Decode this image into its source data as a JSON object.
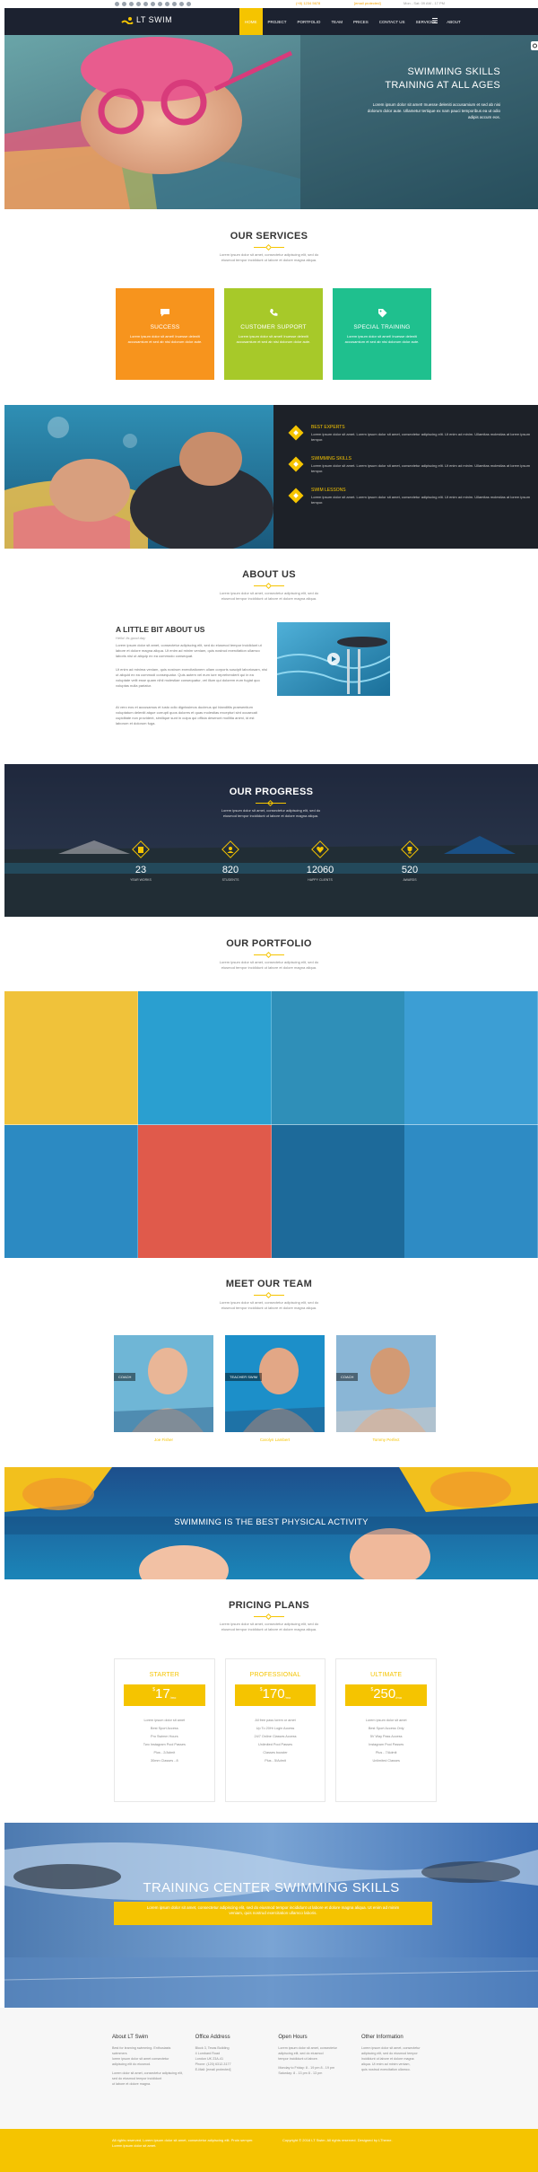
{
  "topbar": {
    "social_icons": [
      "facebook-icon",
      "twitter-icon",
      "google-plus-icon",
      "pinterest-icon",
      "linkedin-icon",
      "youtube-icon",
      "dribbble-icon",
      "instagram-icon",
      "rss-icon",
      "flickr-icon",
      "vimeo-icon"
    ],
    "phone": "(+8) 1234 5678",
    "email": "[email protected]",
    "hours": "Mon - Sat: 09 AM - 17 PM"
  },
  "nav": {
    "logo": "LT SWIM",
    "items": [
      "HOME",
      "PROJECT",
      "PORTFOLIO",
      "TEAM",
      "PRICES",
      "CONTACT US",
      "SERVICES",
      "ABOUT"
    ],
    "active_index": 0,
    "accent": "#f5c400",
    "bg": "#1c2230"
  },
  "hero": {
    "title_line1": "SWIMMING SKILLS",
    "title_line2": "TRAINING AT ALL AGES",
    "text": "Lorem ipsum dolor sit amet! Inuesse deleniti accusamium et sed ab nisi dolorum dolor aute. Ullametur tertique ex nam pauci temporibus ea ut odio adipis accum eos."
  },
  "services": {
    "title": "OUR SERVICES",
    "subtitle": "Lorem ipsum dolor sit amet, consectetur adipiscing elit, sed do eiusmod tempor incididunt ut labore et dolore magna aliqua.",
    "cards": [
      {
        "icon": "chat-icon",
        "title": "SUCCESS",
        "text": "Lorem ipsum dolor sit amet! Inuesse deleniti accusamium et sed ab nisi dolorum dolor aute.",
        "color": "#f7941d"
      },
      {
        "icon": "phone-icon",
        "title": "CUSTOMER SUPPORT",
        "text": "Lorem ipsum dolor sit amet! Inuesse deleniti accusamium et sed ab nisi dolorum dolor aute.",
        "color": "#a7c929"
      },
      {
        "icon": "tag-icon",
        "title": "SPECIAL TRAINING",
        "text": "Lorem ipsum dolor sit amet! Inuesse deleniti accusamium et sed ab nisi dolorum dolor aute.",
        "color": "#1fc08e"
      }
    ]
  },
  "features": {
    "items": [
      {
        "title": "BEST EXPERTS",
        "text": "Lorem ipsum dolor sit amet. Lorem ipsum dolor sit amet, consectetur adipiscing elit. Ut enim ad minim. Ullamitas molestias at lorem ipsum tempor."
      },
      {
        "title": "SWIMMING SKILLS",
        "text": "Lorem ipsum dolor sit amet. Lorem ipsum dolor sit amet, consectetur adipiscing elit. Ut enim ad minim. Ullamitas molestias at lorem ipsum tempor."
      },
      {
        "title": "SWIM LESSONS",
        "text": "Lorem ipsum dolor sit amet. Lorem ipsum dolor sit amet, consectetur adipiscing elit. Ut enim ad minim. Ullamitas molestias at lorem ipsum tempor."
      }
    ]
  },
  "about": {
    "title": "ABOUT US",
    "subtitle": "Lorem ipsum dolor sit amet, consectetur adipiscing elit, sed do eiusmod tempor incididunt ut labore et dolore magna aliqua.",
    "heading": "A LITTLE BIT ABOUT US",
    "tagline": "Hello! Its good day",
    "p1": "Lorem ipsum dolor sit amet, consectetur adipiscing elit, sed do eiusmod tempor incididunt ut labore et dolore magna aliqua. Ut enim ad minim veniam, quis nostrud exercitation ullamco laboris nisi ut aliquip ex ea commodo consequat.",
    "p2": "Ut enim ad minima veniam, quis nostrum exercitationem ullam corporis suscipit laboriosam, nisi ut aliquid ex ea commodi consequatur. Quis autem vel eum iure reprehenderit qui in ea voluptate velit esse quam nihil molestiae consequatur, vel illum qui dolorem eum fugiat quo voluptas nulla pariatur.",
    "p3": "At vero eos et accusamus et iusto odio dignissimos ducimus qui blanditiis praesentium voluptatum deleniti atque corrupti quos dolores et quas molestias excepturi sint occaecati cupiditate non provident, similique sunt in culpa qui officia deserunt mollitia animi, id est laborum et dolorum fuga."
  },
  "progress": {
    "title": "OUR PROGRESS",
    "subtitle": "Lorem ipsum dolor sit amet, consectetur adipiscing elit, sed do eiusmod tempor incididunt ut labore et dolore magna aliqua.",
    "stats": [
      {
        "icon": "book-icon",
        "value": "23",
        "label": "YEAR WORKS"
      },
      {
        "icon": "users-icon",
        "value": "820",
        "label": "STUDENTS"
      },
      {
        "icon": "heart-icon",
        "value": "12060",
        "label": "HAPPY CLIENTS"
      },
      {
        "icon": "trophy-icon",
        "value": "520",
        "label": "AWARDS"
      }
    ]
  },
  "portfolio": {
    "title": "OUR PORTFOLIO",
    "subtitle": "Lorem ipsum dolor sit amet, consectetur adipiscing elit, sed do eiusmod tempor incididunt ut labore et dolore magna aliqua."
  },
  "team": {
    "title": "MEET OUR TEAM",
    "subtitle": "Lorem ipsum dolor sit amet, consectetur adipiscing elit, sed do eiusmod tempor incididunt ut labore et dolore magna aliqua.",
    "members": [
      {
        "role": "COACH",
        "name": "Joe Fisher"
      },
      {
        "role": "TEACHER SWIM",
        "name": "Carolyn Lambert"
      },
      {
        "role": "COACH",
        "name": "Tommy Perfect"
      }
    ]
  },
  "banner": {
    "text": "SWIMMING IS THE BEST PHYSICAL ACTIVITY"
  },
  "pricing": {
    "title": "PRICING PLANS",
    "subtitle": "Lorem ipsum dolor sit amet, consectetur adipiscing elit, sed do eiusmod tempor incididunt ut labore et dolore magna aliqua.",
    "plans": [
      {
        "name": "STARTER",
        "currency": "$",
        "price": "17",
        "period": "/mo",
        "features": [
          "Lorem ipsum dolor sit amet",
          "Best Sport Access",
          "Pro Swimm Hours",
          "Two Instagram Pool Passes",
          "Plus - 2/Admit",
          "30mm Classes - 8"
        ]
      },
      {
        "name": "PROFESSIONAL",
        "currency": "$",
        "price": "170",
        "period": "/mo",
        "features": [
          "All free pass lorem or amet",
          "Up To 20Hr Login Access",
          "24/7 Online Classes Access",
          "Unlimited Pool Passes",
          "Classes booster",
          "Plus - 5/Admit"
        ]
      },
      {
        "name": "ULTIMATE",
        "currency": "$",
        "price": "250",
        "period": "/mo",
        "features": [
          "Lorem ipsum dolor sit amet",
          "Best Sport Access Only",
          "5V Way Pass Access",
          "Instagram Pool Passes",
          "Plus - 7/Admit",
          "Unlimited Classes"
        ]
      }
    ]
  },
  "cta": {
    "title": "TRAINING CENTER SWIMMING SKILLS",
    "text": "Lorem ipsum dolor sit amet, consectetur adipiscing elit, sed do eiusmod tempor incididunt ut labore et dolore magna aliqua. Ut enim ad minim veniam, quis nostrud exercitation ullamco laboris."
  },
  "footer": {
    "cols": [
      {
        "title": "About LT Swim",
        "lines": [
          "Best for learning swimming. Enthusiasts swimmers",
          "lorem ipsum dolor sit amet consectetur",
          "adipiscing elit do eiusmod.",
          "",
          "Lorem dolor sit amet, consectetur adipiscing elit, sed do eiusmod tempor incididunt",
          "ut labore et dolore magna."
        ]
      },
      {
        "title": "Office Address",
        "lines": [
          "Block 3, Texas Building",
          "4 Lombard Road",
          "London UK 23A-41",
          "Phone: (120) 6312-3177",
          "E-Mail: [email protected]"
        ]
      },
      {
        "title": "Open Hours",
        "lines": [
          "Lorem ipsum dolor sit amet, consectetur",
          "adipiscing elit, sed do eiusmod",
          "tempor incididunt ut labore.",
          "",
          "Monday to Friday: 8 - 19 pm  8 - 19 pm",
          "Saturday: 8 - 13 pm  8 - 13 pm"
        ]
      },
      {
        "title": "Other Information",
        "lines": [
          "Lorem ipsum dolor sit amet, consectetur",
          "adipiscing elit, sed do eiusmod tempor",
          "incididunt ut labore et dolore magna",
          "aliqua. Ut enim ad minim veniam,",
          "quis nostrud exercitation ullamco."
        ]
      }
    ],
    "bottom_left": "All rights reserved. Lorem ipsum dolor sit amet, consectetur adipiscing elit. Proin semper. Lorem ipsum dolor sit amet.",
    "bottom_right": "Copyright © 2016 LT Swim. All rights reserved. Designed by LTheme.",
    "bg": "#f5c400"
  }
}
